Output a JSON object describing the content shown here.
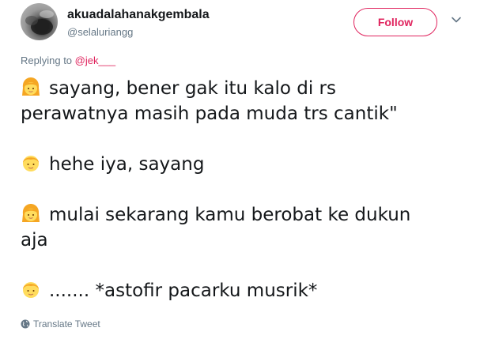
{
  "user": {
    "display_name": "akuadalahanakgembala",
    "handle": "@selaluriangg",
    "avatar_icon": "profile-photo"
  },
  "header": {
    "follow_label": "Follow",
    "menu_icon": "chevron-down-icon",
    "accent_color": "#e0245e"
  },
  "reply": {
    "prefix": "Replying to ",
    "mention": "@jek___"
  },
  "tweet": {
    "paragraphs": [
      {
        "speaker_icon": "girl-emoji-icon",
        "lines": [
          "sayang, bener gak itu kalo di rs",
          "perawatnya masih pada muda trs cantik\""
        ]
      },
      {
        "speaker_icon": "boy-emoji-icon",
        "lines": [
          "hehe iya, sayang"
        ]
      },
      {
        "speaker_icon": "girl-emoji-icon",
        "lines": [
          "mulai sekarang kamu berobat ke dukun",
          "aja"
        ]
      },
      {
        "speaker_icon": "boy-emoji-icon",
        "lines": [
          "....... *astofir pacarku musrik*"
        ]
      }
    ]
  },
  "footer": {
    "translate_label": "Translate Tweet",
    "translate_icon": "globe-icon"
  }
}
